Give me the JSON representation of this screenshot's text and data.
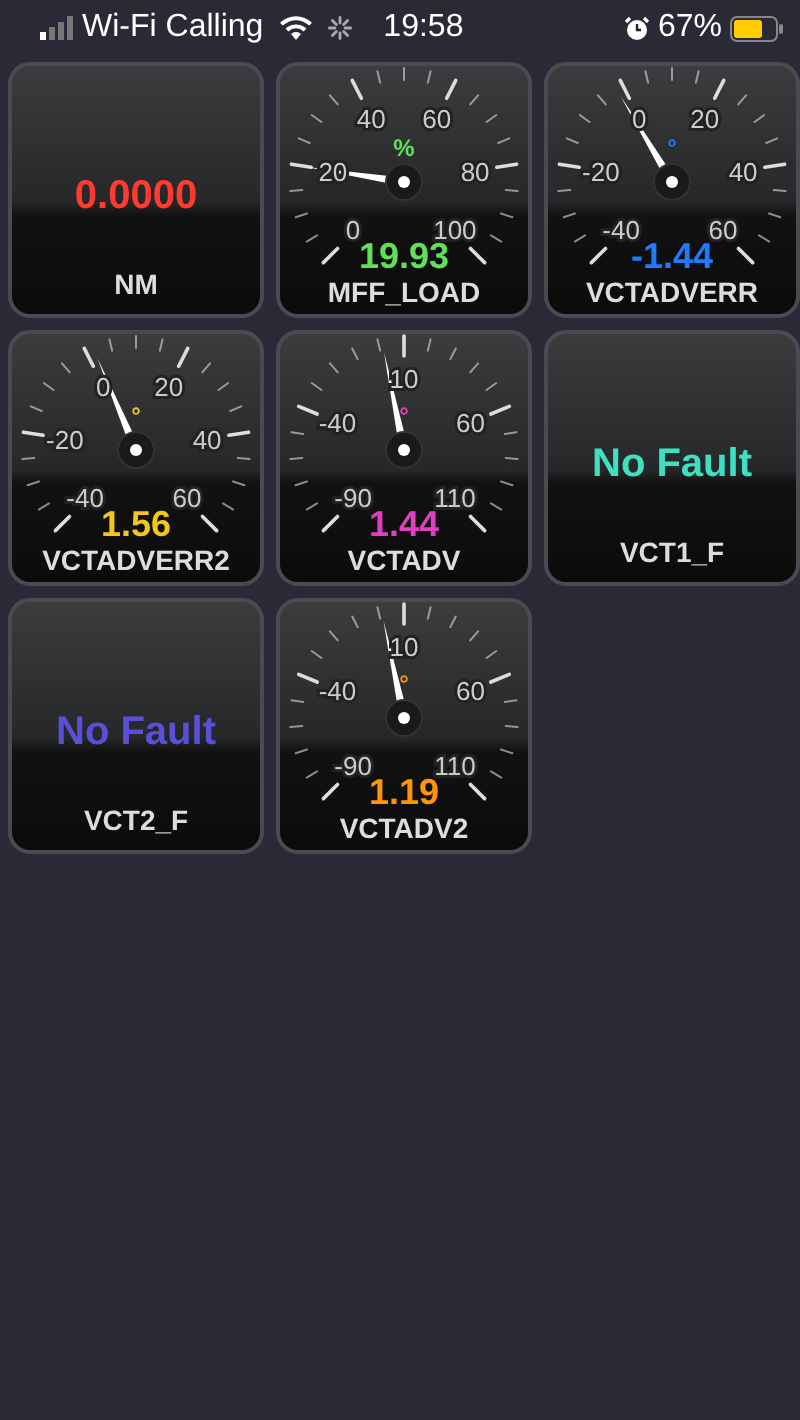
{
  "status_bar": {
    "carrier": "Wi-Fi Calling",
    "time": "19:58",
    "battery": "67%"
  },
  "tiles": [
    {
      "kind": "digital",
      "name": "NM",
      "value": "0.0000",
      "color": "#ff3b30"
    },
    {
      "kind": "gauge",
      "name": "MFF_LOAD",
      "value": "19.93",
      "unit": "%",
      "color": "#5fe05a",
      "dial_labels": [
        "0",
        "20",
        "40",
        "60",
        "80",
        "100"
      ]
    },
    {
      "kind": "gauge",
      "name": "VCTADVERR",
      "value": "-1.44",
      "unit": "°",
      "color": "#1e7bff",
      "dial_labels": [
        "-40",
        "-20",
        "0",
        "20",
        "40",
        "60"
      ]
    },
    {
      "kind": "gauge",
      "name": "VCTADVERR2",
      "value": "1.56",
      "unit": "°",
      "color": "#f5c518",
      "dial_labels": [
        "-40",
        "-20",
        "0",
        "20",
        "40",
        "60"
      ]
    },
    {
      "kind": "gauge",
      "name": "VCTADV",
      "value": "1.44",
      "unit": "°",
      "color": "#e040c0",
      "dial_labels": [
        "-90",
        "-40",
        "10",
        "60",
        "110"
      ]
    },
    {
      "kind": "digital",
      "name": "VCT1_F",
      "value": "No Fault",
      "color": "#3de0c0"
    },
    {
      "kind": "digital",
      "name": "VCT2_F",
      "value": "No Fault",
      "color": "#5a4fd8"
    },
    {
      "kind": "gauge",
      "name": "VCTADV2",
      "value": "1.19",
      "unit": "°",
      "color": "#ff9500",
      "dial_labels": [
        "-90",
        "-40",
        "10",
        "60",
        "110"
      ]
    }
  ]
}
